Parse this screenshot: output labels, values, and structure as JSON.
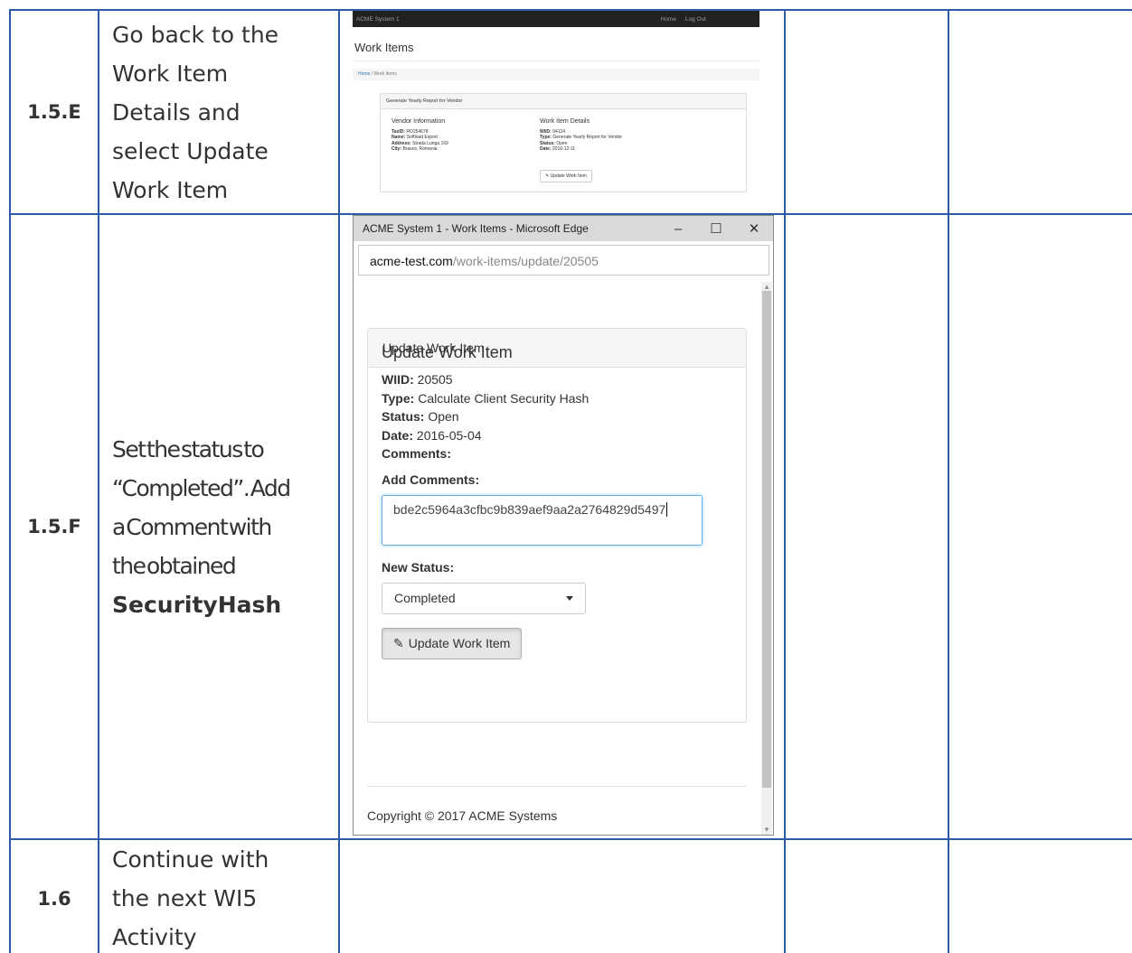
{
  "rows": [
    {
      "step": "1.5.E",
      "desc_lines": [
        "Go back to the",
        "Work Item",
        "Details and",
        "select Update",
        "Work Item"
      ]
    },
    {
      "step": "1.5.F",
      "desc_lines": [
        "Set the status to",
        "“Completed”. Add",
        "a Comment with",
        "the obtained"
      ],
      "desc_bold": "SecurityHash"
    },
    {
      "step": "1.6",
      "desc_lines": [
        "Continue with",
        "the next WI5",
        "Activity"
      ]
    }
  ],
  "screenshot1": {
    "brand": "ACME System 1",
    "nav_items": [
      "Home",
      "Log Out"
    ],
    "heading": "Work Items",
    "breadcrumb": [
      "Home",
      "Work Items"
    ],
    "panel_title": "Generate Yearly Report for Vendor",
    "vendor": {
      "title": "Vendor Information",
      "taxid_label": "TaxID:",
      "taxid": "RO254678",
      "name_label": "Name:",
      "name": "Softload Export",
      "address_label": "Address:",
      "address": "Strada Lunga 169",
      "city_label": "City:",
      "city": "Brasov, Romania"
    },
    "details": {
      "title": "Work Item Details",
      "wiid_label": "WIID:",
      "wiid": "94124",
      "type_label": "Type:",
      "type": "Generate Yearly Report for Vendor",
      "status_label": "Status:",
      "status": "Open",
      "date_label": "Date:",
      "date": "2016-12-11"
    },
    "button": "Update Work Item"
  },
  "window": {
    "title": "ACME System 1 - Work Items - Microsoft Edge",
    "url_host": "acme-test.com",
    "url_path": "/work-items/update/20505",
    "panel_header": "Update Work Item",
    "heading": "Update Work Item",
    "wiid_label": "WIID:",
    "wiid": "20505",
    "type_label": "Type:",
    "type": "Calculate Client Security Hash",
    "status_label": "Status:",
    "status": "Open",
    "date_label": "Date:",
    "date": "2016-05-04",
    "comments_label": "Comments:",
    "add_comments_label": "Add Comments:",
    "comment_value": "bde2c5964a3cfbc9b839aef9aa2a2764829d5497",
    "new_status_label": "New Status:",
    "new_status_value": "Completed",
    "button": "Update Work Item",
    "footer": "Copyright © 2017 ACME Systems"
  }
}
